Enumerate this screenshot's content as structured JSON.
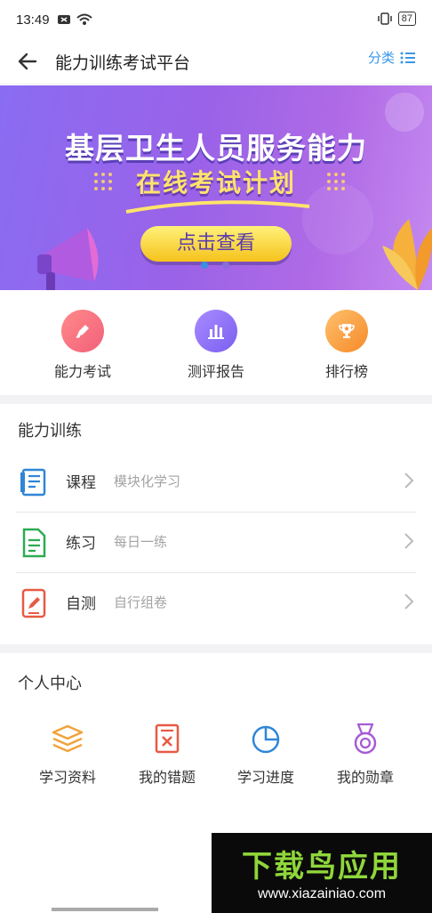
{
  "status": {
    "time": "13:49",
    "battery": "87"
  },
  "header": {
    "title": "能力训练考试平台",
    "category_label": "分类"
  },
  "banner": {
    "line1": "基层卫生人员服务能力",
    "line2": "在线考试计划",
    "cta": "点击查看"
  },
  "quick": [
    {
      "label": "能力考试",
      "icon": "pen-icon",
      "color": "#f2607a"
    },
    {
      "label": "测评报告",
      "icon": "bar-chart-icon",
      "color": "#8a6ff0"
    },
    {
      "label": "排行榜",
      "icon": "trophy-icon",
      "color": "#f79d3a"
    }
  ],
  "training": {
    "title": "能力训练",
    "items": [
      {
        "title": "课程",
        "subtitle": "模块化学习",
        "icon": "book-icon",
        "color": "#2f86d8"
      },
      {
        "title": "练习",
        "subtitle": "每日一练",
        "icon": "document-icon",
        "color": "#2eaa52"
      },
      {
        "title": "自测",
        "subtitle": "自行组卷",
        "icon": "edit-tablet-icon",
        "color": "#e75a43"
      }
    ]
  },
  "personal": {
    "title": "个人中心",
    "items": [
      {
        "label": "学习资料",
        "icon": "layers-icon",
        "color": "#f2a23a"
      },
      {
        "label": "我的错题",
        "icon": "wrong-questions-icon",
        "color": "#e75a43"
      },
      {
        "label": "学习进度",
        "icon": "pie-chart-icon",
        "color": "#2f86d8"
      },
      {
        "label": "我的勋章",
        "icon": "medal-icon",
        "color": "#a65cd6"
      }
    ]
  },
  "watermark": {
    "main": "下载鸟应用",
    "url": "www.xiazainiao.com"
  }
}
